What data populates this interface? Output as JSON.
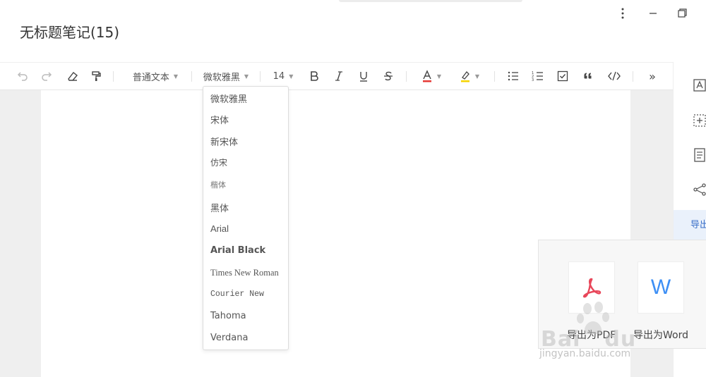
{
  "window": {
    "title": "无标题笔记(15)"
  },
  "toolbar": {
    "paragraph_style": "普通文本",
    "font_family": "微软雅黑",
    "font_size": "14",
    "more": "»"
  },
  "font_menu": {
    "items": [
      "微软雅黑",
      "宋体",
      "新宋体",
      "仿宋",
      "楷体",
      "黑体",
      "Arial",
      "Arial Black",
      "Times New Roman",
      "Courier New",
      "Tahoma",
      "Verdana"
    ]
  },
  "sidebar": {
    "export_label": "导出"
  },
  "export_popup": {
    "pdf_label": "导出为PDF",
    "word_label": "导出为Word",
    "word_glyph": "W"
  },
  "watermark": {
    "brand": "Bai",
    "brand2": "du",
    "url": "jingyan.baidu.com"
  },
  "colors": {
    "accent": "#3a6fc8",
    "pdf_red": "#e8475a",
    "word_blue": "#3d8ff5",
    "highlight": "#f5d300",
    "font_color_bar": "#e53935"
  }
}
